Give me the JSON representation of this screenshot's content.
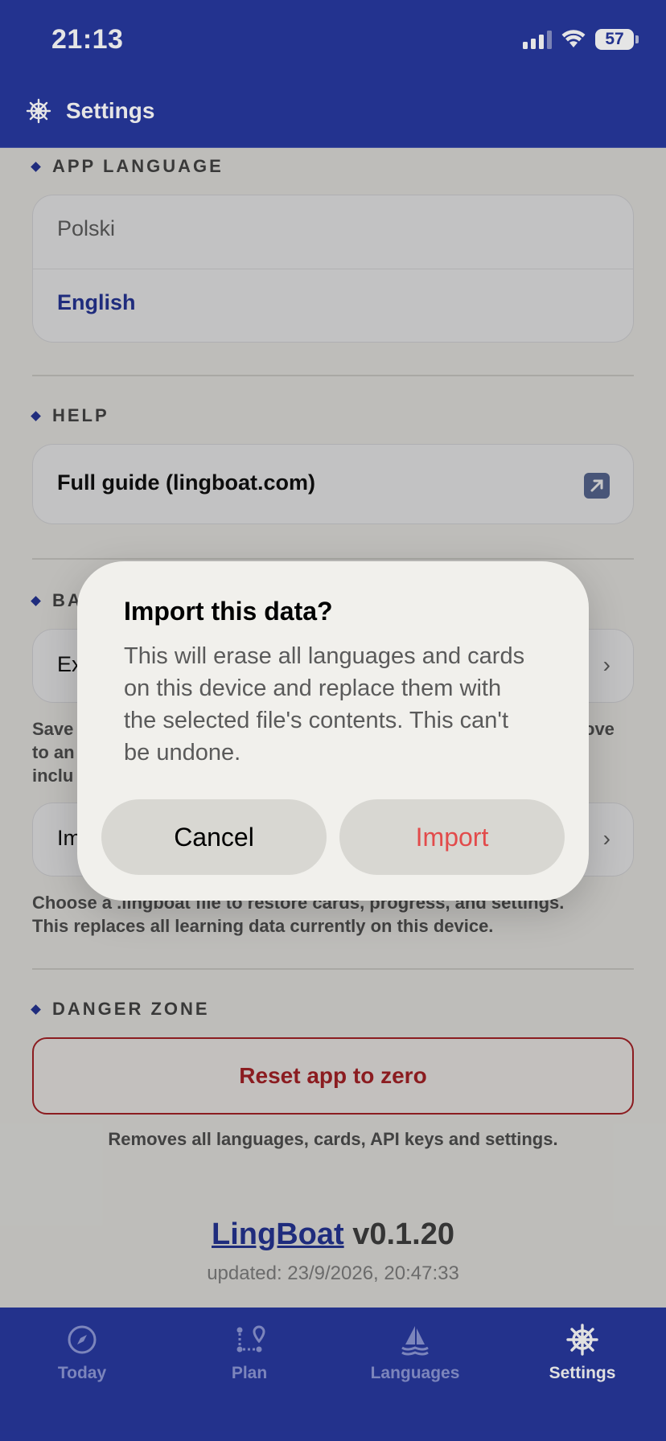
{
  "status_bar": {
    "time": "21:13",
    "battery": "57"
  },
  "header": {
    "title": "Settings"
  },
  "sections": {
    "app_language": {
      "label": "APP LANGUAGE",
      "options": [
        "Polski",
        "English"
      ]
    },
    "help": {
      "label": "HELP",
      "guide_label": "Full guide (lingboat.com)"
    },
    "backup": {
      "label": "BA",
      "export_label": "Ex",
      "export_hint": [
        "Save",
        "ove",
        "to an",
        "inclu"
      ],
      "import_label": "Im",
      "import_hint_line1": "Choose a .lingboat file to restore cards, progress, and settings.",
      "import_hint_line2": "This replaces all learning data currently on this device."
    },
    "danger_zone": {
      "label": "DANGER ZONE",
      "reset_label": "Reset app to zero",
      "reset_hint": "Removes all languages, cards, API keys and settings."
    }
  },
  "footer": {
    "brand": "LingBoat",
    "version": "v0.1.20",
    "updated": "updated: 23/9/2026, 20:47:33"
  },
  "tabs": [
    "Today",
    "Plan",
    "Languages",
    "Settings"
  ],
  "dialog": {
    "title": "Import this data?",
    "body": "This will erase all languages and cards on this device and replace them with the selected file's contents. This can't be undone.",
    "cancel_label": "Cancel",
    "confirm_label": "Import"
  },
  "colors": {
    "brand_blue": "#2839a0",
    "danger_red": "#b3252a",
    "confirm_red": "#e24b4b"
  }
}
